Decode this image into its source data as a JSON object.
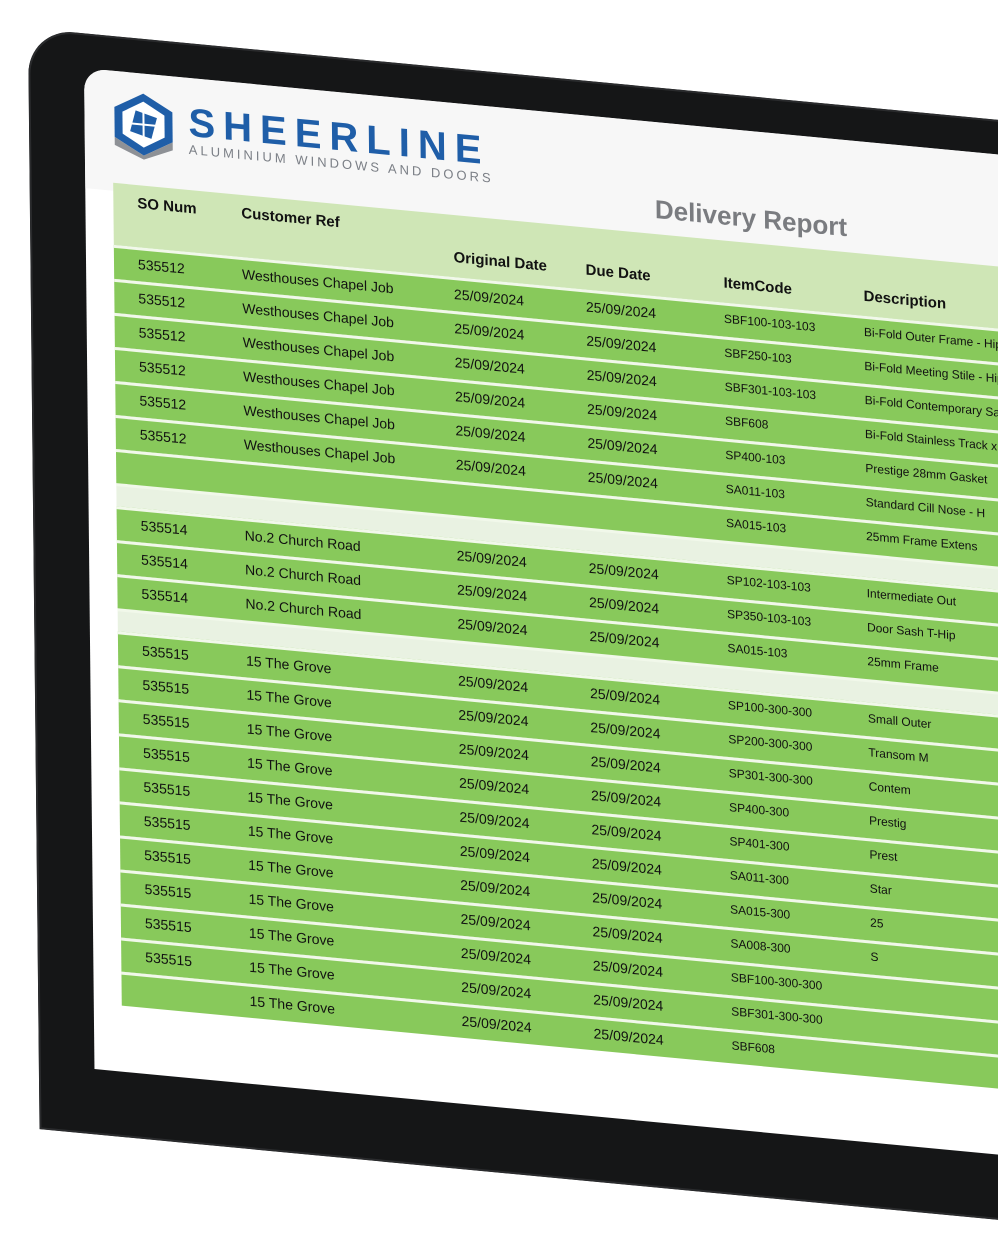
{
  "brand": {
    "name": "SHEERLINE",
    "tagline": "ALUMINIUM WINDOWS AND DOORS"
  },
  "report": {
    "title": "Delivery Report"
  },
  "table": {
    "headers": [
      "SO Num",
      "Customer Ref",
      "Original Date",
      "Due Date",
      "ItemCode",
      "Description"
    ],
    "groups": [
      {
        "rows": [
          [
            "535512",
            "Westhouses Chapel Job",
            "25/09/2024",
            "25/09/2024",
            "SBF100-103-103",
            "Bi-Fold Outer Frame - Hipca W"
          ],
          [
            "535512",
            "Westhouses Chapel Job",
            "25/09/2024",
            "25/09/2024",
            "SBF250-103",
            "Bi-Fold Meeting Stile - Hipca"
          ],
          [
            "535512",
            "Westhouses Chapel Job",
            "25/09/2024",
            "25/09/2024",
            "SBF301-103-103",
            "Bi-Fold Contemporary Sash"
          ],
          [
            "535512",
            "Westhouses Chapel Job",
            "25/09/2024",
            "25/09/2024",
            "SBF608",
            "Bi-Fold Stainless Track x"
          ],
          [
            "535512",
            "Westhouses Chapel Job",
            "25/09/2024",
            "25/09/2024",
            "SP400-103",
            "Prestige 28mm Gasket"
          ],
          [
            "535512",
            "Westhouses Chapel Job",
            "25/09/2024",
            "25/09/2024",
            "SA011-103",
            "Standard Cill Nose - H"
          ],
          [
            "",
            "",
            "",
            "",
            "SA015-103",
            "25mm Frame Extens"
          ]
        ]
      },
      {
        "rows": [
          [
            "535514",
            "No.2 Church Road",
            "25/09/2024",
            "25/09/2024",
            "SP102-103-103",
            "Intermediate Out"
          ],
          [
            "535514",
            "No.2 Church Road",
            "25/09/2024",
            "25/09/2024",
            "SP350-103-103",
            "Door Sash T-Hip"
          ],
          [
            "535514",
            "No.2 Church Road",
            "25/09/2024",
            "25/09/2024",
            "SA015-103",
            "25mm Frame"
          ]
        ]
      },
      {
        "rows": [
          [
            "535515",
            "15 The Grove",
            "25/09/2024",
            "25/09/2024",
            "SP100-300-300",
            "Small Outer"
          ],
          [
            "535515",
            "15 The Grove",
            "25/09/2024",
            "25/09/2024",
            "SP200-300-300",
            "Transom M"
          ],
          [
            "535515",
            "15 The Grove",
            "25/09/2024",
            "25/09/2024",
            "SP301-300-300",
            "Contem"
          ],
          [
            "535515",
            "15 The Grove",
            "25/09/2024",
            "25/09/2024",
            "SP400-300",
            "Prestig"
          ],
          [
            "535515",
            "15 The Grove",
            "25/09/2024",
            "25/09/2024",
            "SP401-300",
            "Prest"
          ],
          [
            "535515",
            "15 The Grove",
            "25/09/2024",
            "25/09/2024",
            "SA011-300",
            "Star"
          ],
          [
            "535515",
            "15 The Grove",
            "25/09/2024",
            "25/09/2024",
            "SA015-300",
            "25"
          ],
          [
            "535515",
            "15 The Grove",
            "25/09/2024",
            "25/09/2024",
            "SA008-300",
            "S"
          ],
          [
            "535515",
            "15 The Grove",
            "25/09/2024",
            "25/09/2024",
            "SBF100-300-300",
            ""
          ],
          [
            "535515",
            "15 The Grove",
            "25/09/2024",
            "25/09/2024",
            "SBF301-300-300",
            ""
          ],
          [
            "",
            "15 The Grove",
            "25/09/2024",
            "25/09/2024",
            "SBF608",
            ""
          ]
        ]
      }
    ]
  },
  "colors": {
    "row_green": "#88c95b",
    "header_green": "#cfe6b6",
    "brand_blue": "#1f5ea8",
    "bezel": "#151617"
  }
}
